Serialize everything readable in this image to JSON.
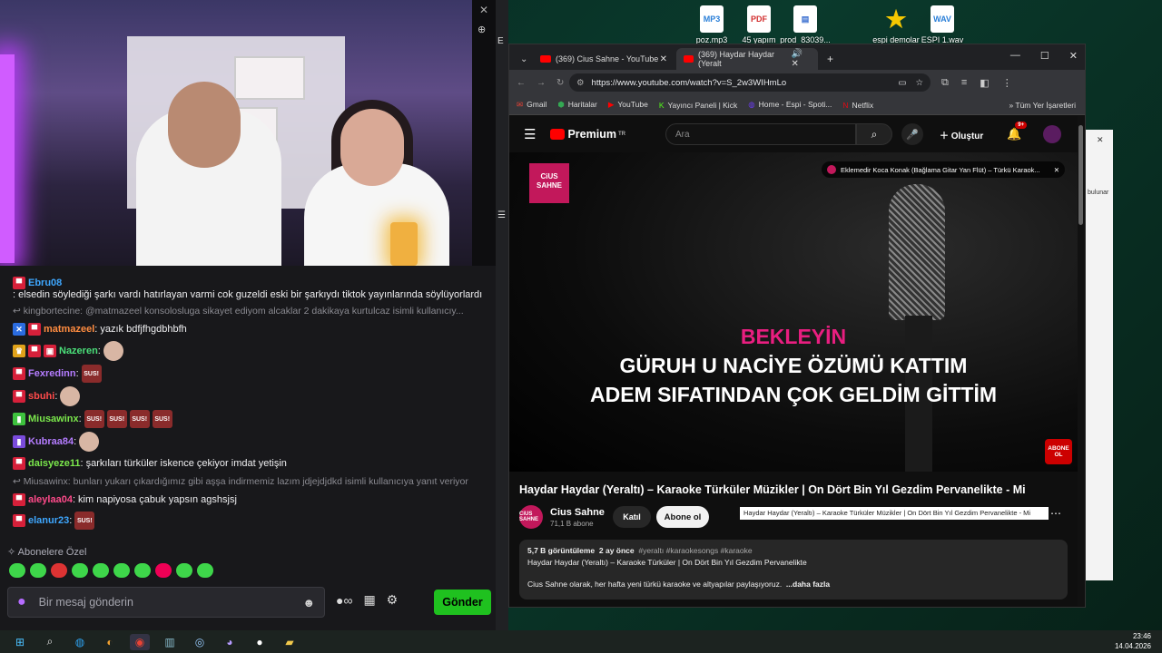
{
  "desktop": {
    "icons": [
      {
        "label": "poz.mp3",
        "glyph": "MP3",
        "color": "#2a7fd8"
      },
      {
        "label": "45 yapım",
        "glyph": "PDF",
        "color": "#d32f2f"
      },
      {
        "label": "prod_83039...",
        "glyph": "▤",
        "color": "#3b6fd0"
      },
      {
        "label": "espi demolar",
        "glyph": "★",
        "color": "#f6c800"
      },
      {
        "label": "ESPI 1.wav",
        "glyph": "WAV",
        "color": "#2a7fd8"
      }
    ]
  },
  "stream": {
    "messages": [
      {
        "user": "Ebru08",
        "color": "#3ea7ff",
        "text": ": elsedin söylediği şarkı vardı hatırlayan varmi cok guzeldi eski bir şarkıydı tiktok yayınlarında söylüyorlardı",
        "badges": [
          "m"
        ]
      },
      {
        "reply": "kingbortecine: @matmazeel konsoloslugа sikayet ediyom alcaklar 2 dakikaya kurtulcaz isimli kullanıcıy..."
      },
      {
        "user": "matmazeel",
        "color": "#ff8c40",
        "text": ": yazık bdfjfhgdbhbfh",
        "badges": [
          "x",
          "m"
        ]
      },
      {
        "user": "Nazeren",
        "color": "#4be07a",
        "text": ":",
        "badges": [
          "c",
          "m",
          "g"
        ],
        "face": true
      },
      {
        "user": "Fexredinn",
        "color": "#b47cff",
        "text": ":",
        "badges": [
          "m"
        ],
        "emotes": [
          "SUS!"
        ]
      },
      {
        "user": "sbuhi",
        "color": "#ff4a4a",
        "text": ":",
        "badges": [
          "m"
        ],
        "face": true
      },
      {
        "user": "Miusawinx",
        "color": "#7be84c",
        "text": ":",
        "badges": [
          "g2"
        ],
        "emotes": [
          "SUS!",
          "SUS!",
          "SUS!",
          "SUS!"
        ]
      },
      {
        "user": "Kubraa84",
        "color": "#b47cff",
        "text": ":",
        "badges": [
          "p"
        ],
        "face": true
      },
      {
        "user": "daisyeze11",
        "color": "#7be84c",
        "text": ": şarkıları türküler iskence çekiyor imdat yetişin",
        "badges": [
          "m"
        ]
      },
      {
        "reply": "Miusawinx: bunları yukarı çıkardığımız gibi aşşa indirmemiz lazım jdjejdjdkd isimli kullanıcıya yanıt veriyor"
      },
      {
        "user": "aleylaa04",
        "color": "#ff4a8a",
        "text": ": kim napiyosa çabuk yapsın agshsjsj",
        "badges": [
          "m"
        ]
      },
      {
        "user": "elanur23",
        "color": "#3ea7ff",
        "text": ":",
        "badges": [
          "m"
        ],
        "emotes": [
          "SUS!"
        ]
      }
    ],
    "sub_only": "Abonelere Özel",
    "input_placeholder": "Bir mesaj gönderin",
    "send_label": "Gönder"
  },
  "browser": {
    "tabs": [
      {
        "title": "(369) Cius Sahne - YouTube"
      },
      {
        "title": "(369) Haydar Haydar (Yeralt"
      }
    ],
    "url": "https://www.youtube.com/watch?v=S_2w3WIHmLo",
    "bookmarks": [
      "Gmail",
      "Haritalar",
      "YouTube",
      "Yayıncı Paneli | Kick",
      "Home - Espi - Spoti...",
      "Netflix"
    ],
    "bookmarks_right": "Tüm Yer İşaretleri",
    "new_tab_glyph": "+"
  },
  "youtube": {
    "brand": "Premium",
    "region": "TR",
    "search_placeholder": "Ara",
    "create_label": "Oluştur",
    "notif_count": "9+",
    "channel_logo": "CiUS SAHNE",
    "next_up": "Eklemedir Koca Konak (Bağlama Gitar Yan Flüt) – Türkü Karaok...",
    "lyrics": [
      "BEKLEYİN",
      "GÜRUH U NACİYE ÖZÜMÜ KATTIM",
      "ADEM SIFATINDAN ÇOK GELDİM GİTTİM"
    ],
    "abone_badge": "ABONE OL",
    "video_title": "Haydar Haydar (Yeraltı) – Karaoke Türküler Müzikler | On Dört Bin Yıl Gezdim Pervanelikte - Mi",
    "channel_name": "Cius Sahne",
    "subscribers": "71,1 B abone",
    "join_label": "Katıl",
    "subscribe_label": "Abone ol",
    "tooltip": "Haydar Haydar (Yeraltı) – Karaoke Türküler Müzikler | On Dört Bin Yıl Gezdim Pervanelikte - Mi",
    "views": "5,7 B görüntüleme",
    "age": "2 ay önce",
    "tags": "#yeraltı #karaokesongs #karaoke",
    "desc_line1": "Haydar Haydar (Yeraltı) – Karaoke Türküler | On Dört Bin Yıl Gezdim Pervanelikte",
    "desc_line2": "Cius Sahne olarak, her hafta yeni türkü karaoke ve altyapılar paylaşıyoruz.",
    "desc_more": "...daha fazla"
  },
  "right_window": {
    "text1": "bulunar"
  },
  "clock": {
    "time": "23:46",
    "date": "14.04.2026"
  }
}
